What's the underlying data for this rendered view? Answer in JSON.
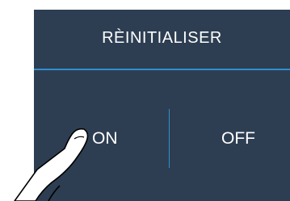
{
  "dialog": {
    "title": "RÈINITIALISER",
    "option_on": "ON",
    "option_off": "OFF"
  },
  "colors": {
    "panel_background": "#2d3e52",
    "divider": "#2f8fd0",
    "text": "#ffffff"
  },
  "icons": {
    "pointer": "hand-pointer-icon"
  }
}
